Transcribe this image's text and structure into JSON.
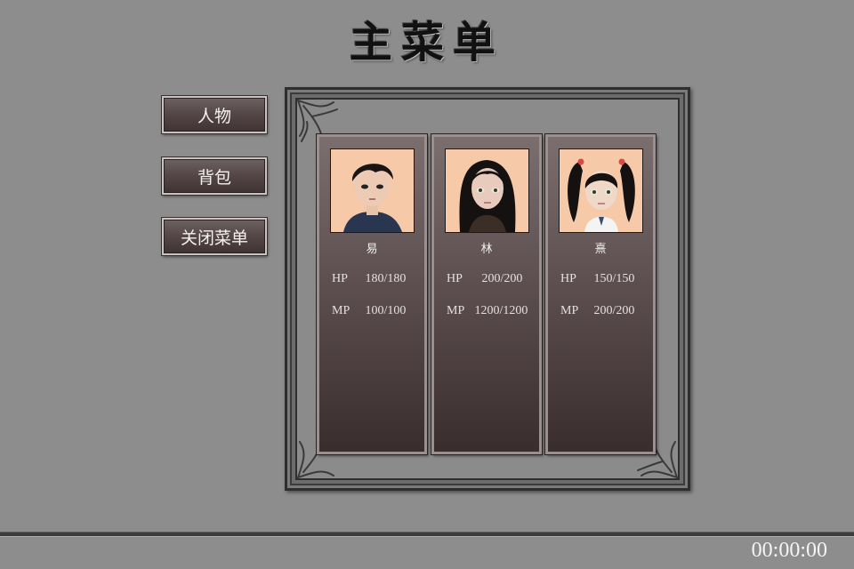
{
  "title": "主菜单",
  "menu": {
    "items": [
      {
        "label": "人物"
      },
      {
        "label": "背包"
      },
      {
        "label": "关闭菜单"
      }
    ]
  },
  "party": [
    {
      "name": "易",
      "hp_label": "HP",
      "hp": "180/180",
      "mp_label": "MP",
      "mp": "100/100",
      "portrait": "boy-short-black-hair-icon"
    },
    {
      "name": "林",
      "hp_label": "HP",
      "hp": "200/200",
      "mp_label": "MP",
      "mp": "1200/1200",
      "portrait": "girl-long-black-hair-icon"
    },
    {
      "name": "熹",
      "hp_label": "HP",
      "hp": "150/150",
      "mp_label": "MP",
      "mp": "200/200",
      "portrait": "girl-twin-tails-icon"
    }
  ],
  "clock": "00:00:00",
  "colors": {
    "background": "#8d8d8d",
    "button": "#564848",
    "card_top": "#7b6e6e",
    "card_bottom": "#3a2d2d",
    "portrait_bg": "#f6c9a9"
  }
}
